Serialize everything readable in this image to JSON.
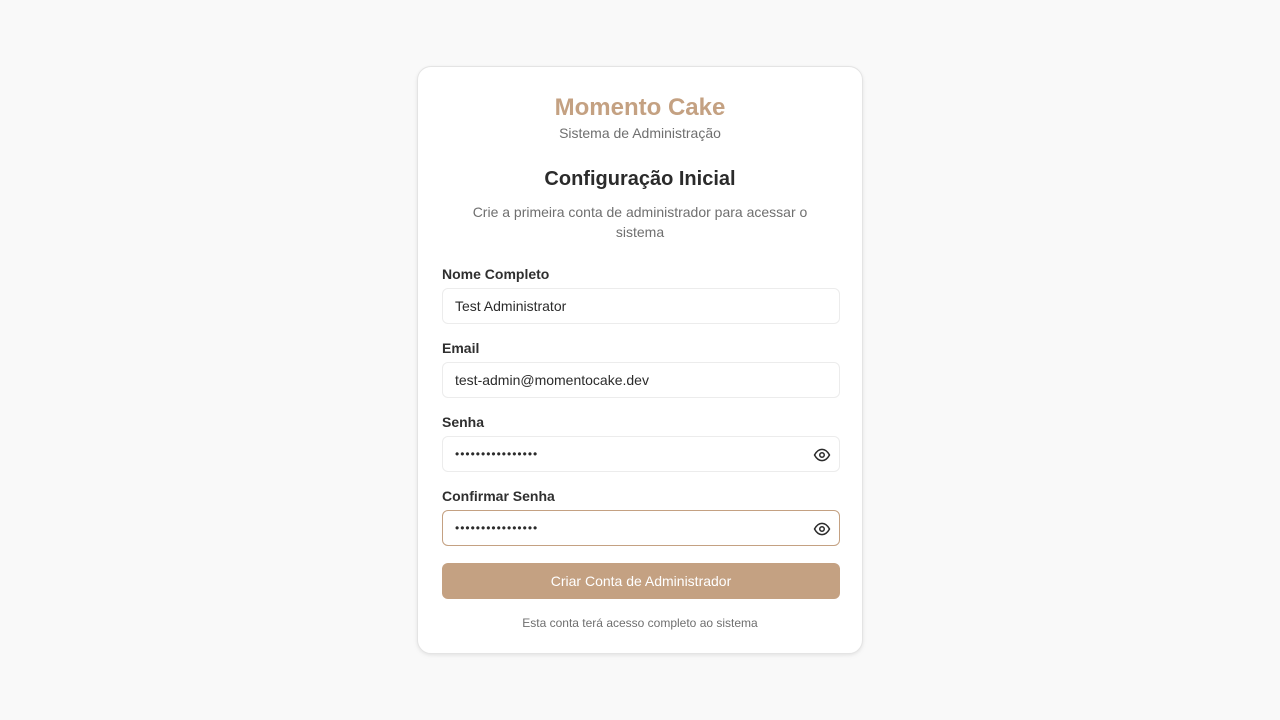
{
  "brand": {
    "title": "Momento Cake",
    "subtitle": "Sistema de Administração"
  },
  "form": {
    "heading": "Configuração Inicial",
    "description": "Crie a primeira conta de administrador para acessar o sistema",
    "fields": {
      "name": {
        "label": "Nome Completo",
        "value": "Test Administrator"
      },
      "email": {
        "label": "Email",
        "value": "test-admin@momentocake.dev"
      },
      "password": {
        "label": "Senha",
        "value": "••••••••••••••••",
        "icon": "eye-icon"
      },
      "confirm_password": {
        "label": "Confirmar Senha",
        "value": "••••••••••••••••",
        "icon": "eye-icon"
      }
    },
    "submit_label": "Criar Conta de Administrador",
    "footnote": "Esta conta terá acesso completo ao sistema"
  },
  "colors": {
    "accent": "#c4a182",
    "background": "#f9f9f9",
    "text": "#2b2b2b",
    "muted": "#6f6f6f"
  }
}
